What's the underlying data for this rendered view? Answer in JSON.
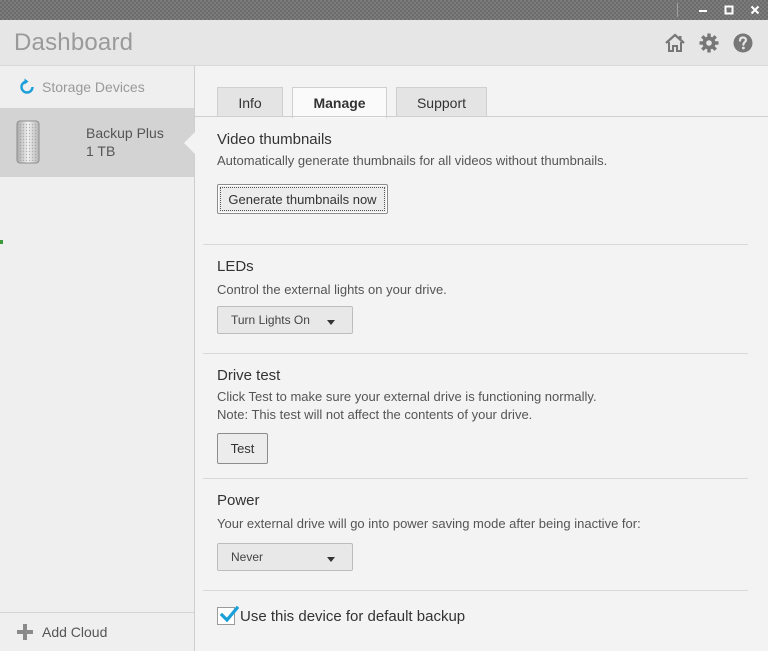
{
  "window": {
    "minimize_icon": "minimize-icon",
    "maximize_icon": "maximize-icon",
    "close_icon": "close-icon"
  },
  "header": {
    "title": "Dashboard",
    "icons": [
      "home-icon",
      "gear-icon",
      "help-icon"
    ]
  },
  "sidebar": {
    "heading": "Storage Devices",
    "device": {
      "name": "Backup Plus",
      "size": "1 TB"
    },
    "add_cloud": "Add Cloud"
  },
  "tabs": [
    {
      "label": "Info"
    },
    {
      "label": "Manage",
      "active": true
    },
    {
      "label": "Support"
    }
  ],
  "sections": {
    "thumbnails": {
      "title": "Video thumbnails",
      "desc": "Automatically generate thumbnails for all videos without thumbnails.",
      "button": "Generate thumbnails now"
    },
    "leds": {
      "title": "LEDs",
      "desc": "Control the external lights on your drive.",
      "selected": "Turn Lights On"
    },
    "drive_test": {
      "title": "Drive test",
      "desc_line1": "Click Test to make sure your external drive is functioning normally.",
      "desc_line2": "Note: This test will not affect the contents of your drive.",
      "button": "Test"
    },
    "power": {
      "title": "Power",
      "desc": "Your external drive will go into power saving mode after being inactive for:",
      "selected": "Never"
    },
    "default_backup": {
      "label": "Use this device for default backup",
      "checked": true
    }
  },
  "colors": {
    "accent": "#1a9fd8",
    "title_gray": "#9a9a9a"
  }
}
